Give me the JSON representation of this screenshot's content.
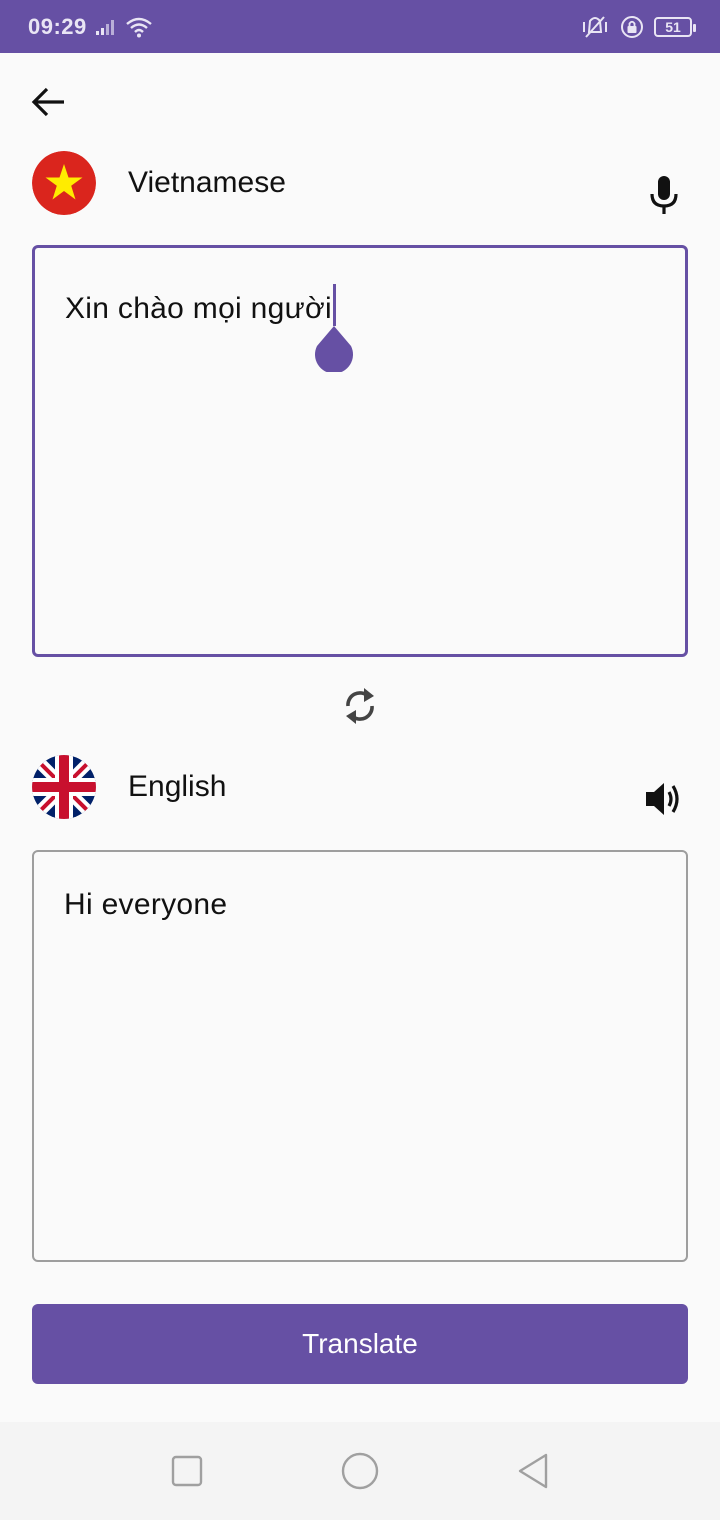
{
  "status_bar": {
    "time": "09:29",
    "battery": "51",
    "icons": [
      "signal-icon",
      "wifi-icon",
      "vibrate-icon",
      "lock-rotation-icon",
      "battery-icon"
    ]
  },
  "source": {
    "language": "Vietnamese",
    "flag": "vietnam-flag-icon",
    "text": "Xin chào mọi người",
    "action_icon": "microphone-icon"
  },
  "target": {
    "language": "English",
    "flag": "uk-flag-icon",
    "text": "Hi everyone",
    "action_icon": "speaker-icon"
  },
  "actions": {
    "translate_label": "Translate",
    "swap_icon": "swap-icon",
    "back_icon": "back-arrow-icon"
  },
  "colors": {
    "accent": "#6650a4",
    "background": "#fafafa",
    "inactive_border": "#9e9e9e"
  },
  "nav_bar": {
    "icons": [
      "recent-apps-icon",
      "home-icon",
      "back-icon"
    ]
  }
}
